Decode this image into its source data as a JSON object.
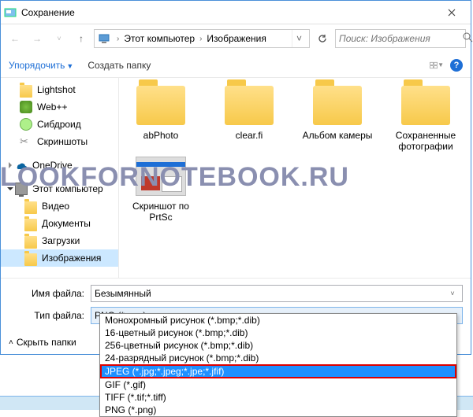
{
  "window": {
    "title": "Сохранение"
  },
  "breadcrumb": {
    "part1": "Этот компьютер",
    "part2": "Изображения"
  },
  "search": {
    "placeholder": "Поиск: Изображения"
  },
  "toolbar": {
    "organize": "Упорядочить",
    "newfolder": "Создать папку"
  },
  "tree": {
    "items": [
      {
        "label": "Lightshot",
        "icon": "folder"
      },
      {
        "label": "Web++",
        "icon": "green"
      },
      {
        "label": "Сибдроид",
        "icon": "sib"
      },
      {
        "label": "Скриншоты",
        "icon": "scissors"
      },
      {
        "label": "OneDrive",
        "icon": "onedrive"
      },
      {
        "label": "Этот компьютер",
        "icon": "pc"
      },
      {
        "label": "Видео",
        "icon": "folder"
      },
      {
        "label": "Документы",
        "icon": "folder"
      },
      {
        "label": "Загрузки",
        "icon": "folder"
      },
      {
        "label": "Изображения",
        "icon": "folder",
        "selected": true
      }
    ]
  },
  "folders": [
    {
      "label": "abPhoto"
    },
    {
      "label": "clear.fi"
    },
    {
      "label": "Альбом камеры"
    },
    {
      "label": "Сохраненные фотографии"
    }
  ],
  "thumb": {
    "label": "Скриншот по PrtSc"
  },
  "form": {
    "name_label": "Имя файла:",
    "name_value": "Безымянный",
    "type_label": "Тип файла:",
    "type_value": "PNG (*.png)"
  },
  "footer": {
    "hide": "Скрыть папки"
  },
  "dropdown": {
    "options": [
      "Монохромный рисунок (*.bmp;*.dib)",
      "16-цветный рисунок (*.bmp;*.dib)",
      "256-цветный рисунок (*.bmp;*.dib)",
      "24-разрядный рисунок (*.bmp;*.dib)",
      "JPEG (*.jpg;*.jpeg;*.jpe;*.jfif)",
      "GIF (*.gif)",
      "TIFF (*.tif;*.tiff)",
      "PNG (*.png)"
    ],
    "selected_index": 4
  },
  "watermark": "LOOKFORNOTEBOOK.RU"
}
